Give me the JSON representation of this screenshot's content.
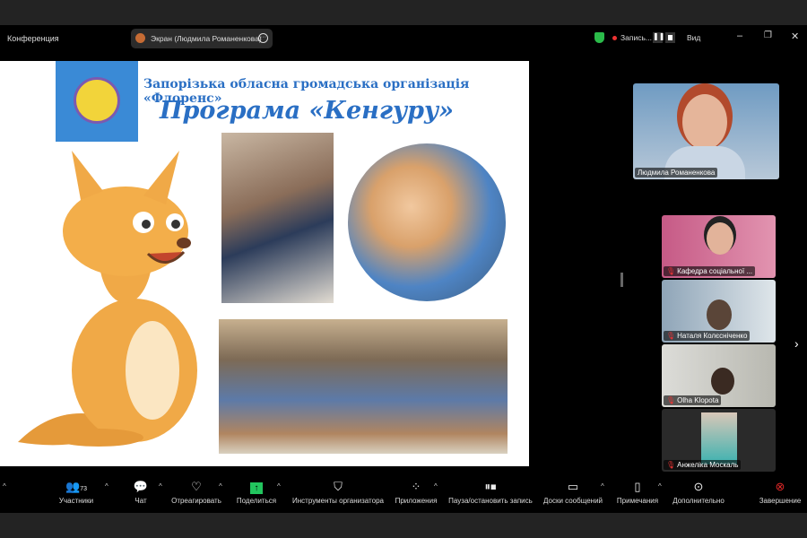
{
  "window": {
    "title": "Конференция",
    "share_label": "Экран (Людмила Романенкова)",
    "recording": "Запись...",
    "view": "Вид"
  },
  "slide": {
    "org": "Запорізька обласна громадська організація «Флоренс»",
    "program": "Програма «Кенгуру»"
  },
  "self_view": {
    "name": "Людмила Романенкова"
  },
  "participants": [
    {
      "name": "Кафедра соціальної ..."
    },
    {
      "name": "Наталя Колєсніченко"
    },
    {
      "name": "Olha Klopota"
    },
    {
      "name": "Анжеліка Москаль"
    }
  ],
  "toolbar": {
    "participants": "Участники",
    "participants_count": "73",
    "chat": "Чат",
    "react": "Отреагировать",
    "share": "Поделиться",
    "host_tools": "Инструменты организатора",
    "apps": "Приложения",
    "pause_record": "Пауза/остановить запись",
    "whiteboards": "Доски сообщений",
    "notes": "Примечания",
    "more": "Дополнительно",
    "end": "Завершение"
  },
  "colors": {
    "share": "#22c55e",
    "end": "#e02828",
    "title": "#2a6fc4"
  }
}
